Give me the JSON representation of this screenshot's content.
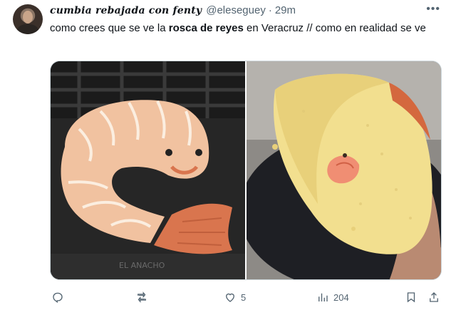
{
  "tweet": {
    "display_name": "cumbia rebajada con fenty",
    "handle": "@eleseguey",
    "separator": "·",
    "time": "29m",
    "more_icon": "more-icon",
    "text_before": "como crees que se ve la ",
    "text_bold": "rosca de reyes",
    "text_after": " en Veracruz // como en realidad se ve"
  },
  "media": {
    "left_image_watermark": "EL ANACHO"
  },
  "actions": {
    "reply_icon": "reply-icon",
    "retweet_icon": "retweet-icon",
    "like_icon": "heart-icon",
    "like_count": "5",
    "views_icon": "views-icon",
    "views_count": "204",
    "bookmark_icon": "bookmark-icon",
    "share_icon": "share-icon"
  },
  "colors": {
    "text_primary": "#0f1419",
    "text_secondary": "#536471",
    "border": "#cfd9de"
  }
}
